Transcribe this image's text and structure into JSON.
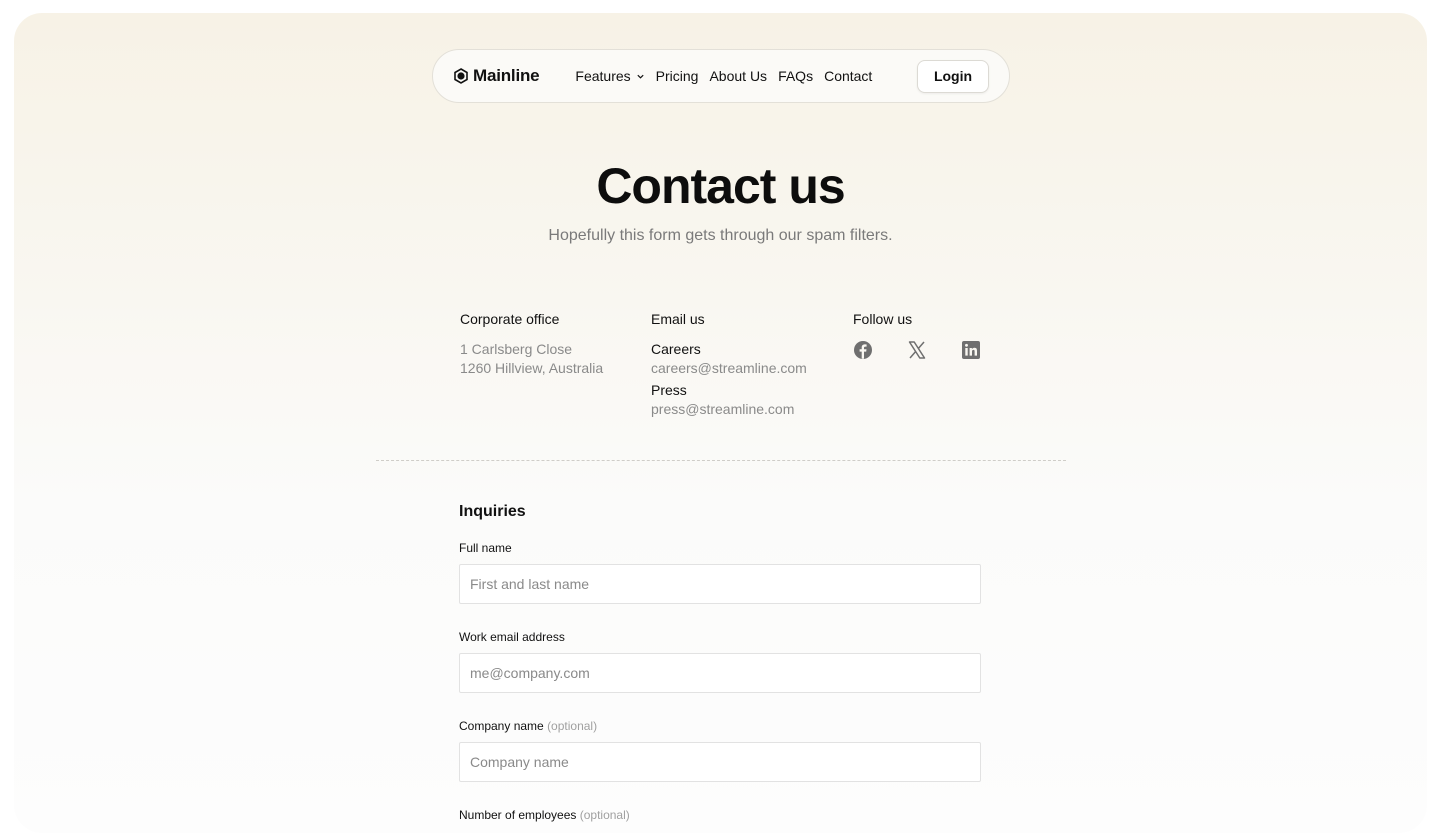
{
  "nav": {
    "brand": "Mainline",
    "features": "Features",
    "pricing": "Pricing",
    "about": "About Us",
    "faqs": "FAQs",
    "contact": "Contact",
    "login": "Login"
  },
  "hero": {
    "title": "Contact us",
    "subtitle": "Hopefully this form gets through our spam filters."
  },
  "office": {
    "heading": "Corporate office",
    "line1": "1 Carlsberg Close",
    "line2": "1260 Hillview, Australia"
  },
  "email": {
    "heading": "Email us",
    "careers_label": "Careers",
    "careers_address": "careers@streamline.com",
    "press_label": "Press",
    "press_address": "press@streamline.com"
  },
  "follow": {
    "heading": "Follow us",
    "icons": [
      "facebook-icon",
      "x-icon",
      "linkedin-icon"
    ]
  },
  "form": {
    "title": "Inquiries",
    "full_name_label": "Full name",
    "full_name_placeholder": "First and last name",
    "email_label": "Work email address",
    "email_placeholder": "me@company.com",
    "company_label": "Company name",
    "company_optional": "(optional)",
    "company_placeholder": "Company name",
    "employees_label": "Number of employees",
    "employees_optional": "(optional)"
  },
  "colors": {
    "accent_text": "#111111",
    "muted_text": "#7a7a7a",
    "background_top": "#f7f2e6"
  }
}
